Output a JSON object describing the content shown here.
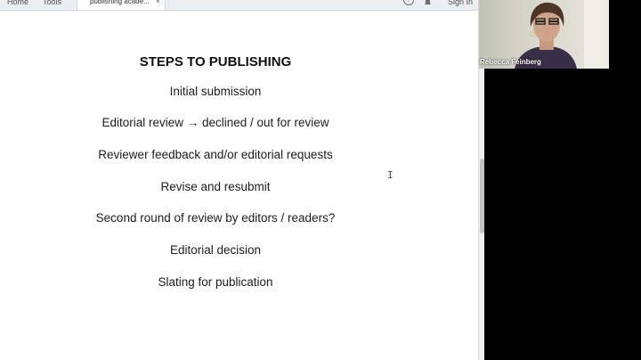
{
  "browser": {
    "home_label": "Home",
    "tools_label": "Tools",
    "tab_label": "publishing acade...",
    "tab_close": "×",
    "help_glyph": "?",
    "signin_label": "Sign In"
  },
  "slide": {
    "title": "STEPS TO PUBLISHING",
    "steps": [
      "Initial submission",
      "Editorial review → declined / out for review",
      "Reviewer feedback and/or editorial requests",
      "Revise and resubmit",
      "Second round of review by editors / readers?",
      "Editorial decision",
      "Slating for publication"
    ]
  },
  "cursor": {
    "glyph": "I"
  },
  "video": {
    "participant_name": "Rebecca Feinberg"
  }
}
